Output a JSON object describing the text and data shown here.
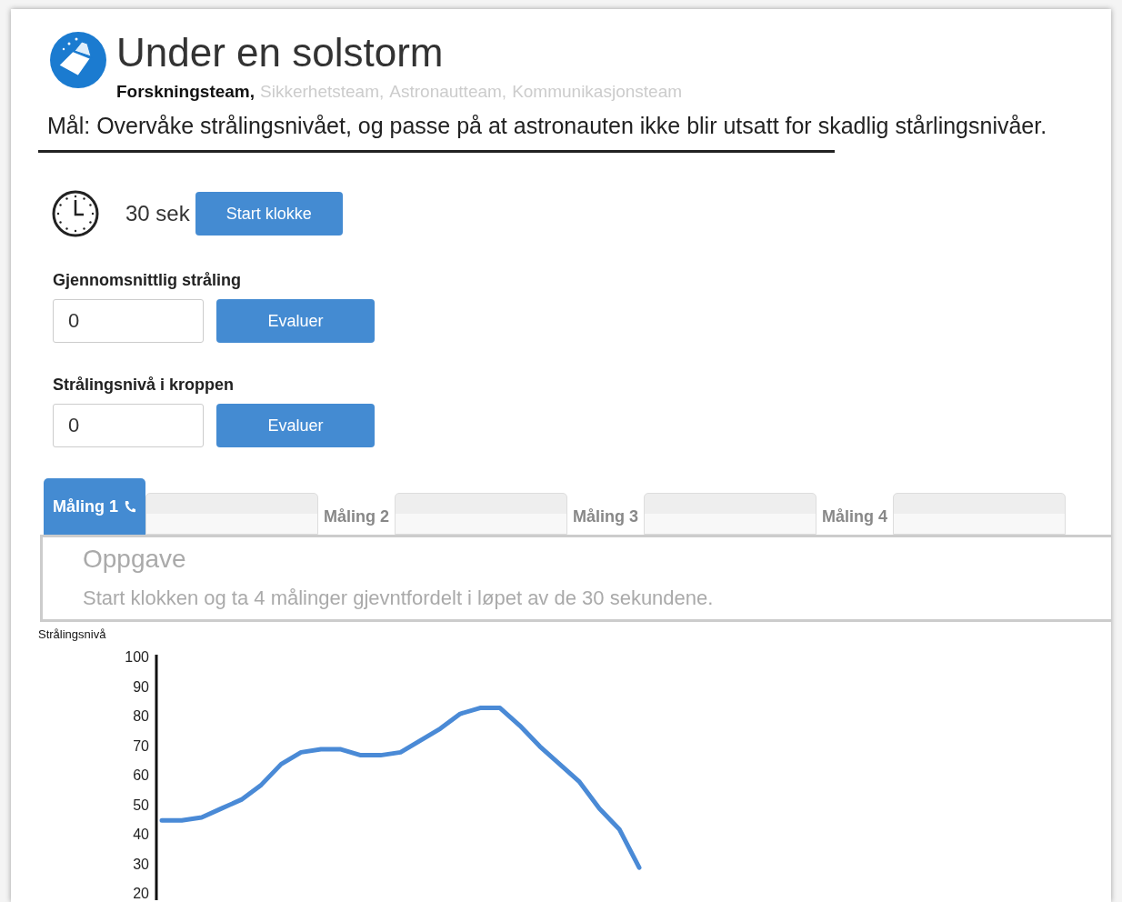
{
  "header": {
    "title": "Under en solstorm",
    "teams": [
      {
        "name": "Forskningsteam,",
        "active": true
      },
      {
        "name": "Sikkerhetsteam,",
        "active": false
      },
      {
        "name": "Astronautteam,",
        "active": false
      },
      {
        "name": "Kommunikasjonsteam",
        "active": false
      }
    ],
    "goal": "Mål: Overvåke strålingsnivået, og passe på at astronauten ikke blir utsatt for skadlig stårlingsnivåer."
  },
  "timer": {
    "time": "30 sek",
    "button": "Start klokke"
  },
  "evaluations": [
    {
      "label": "Gjennomsnittlig stråling",
      "value": "0",
      "button": "Evaluer"
    },
    {
      "label": "Strålingsnivå i kroppen",
      "value": "0",
      "button": "Evaluer"
    }
  ],
  "tabs": [
    {
      "label": "Måling 1",
      "selected": true
    },
    {
      "label": "Måling 2",
      "selected": false
    },
    {
      "label": "Måling 3",
      "selected": false
    },
    {
      "label": "Måling 4",
      "selected": false
    }
  ],
  "task": {
    "title": "Oppgave",
    "text": "Start klokken og ta 4 målinger gjevntfordelt i løpet av de 30 sekundene."
  },
  "chart_data": {
    "type": "line",
    "ylabel": "Strålingsnivå",
    "ylim": [
      17,
      100
    ],
    "yticks": [
      20,
      30,
      40,
      50,
      60,
      70,
      80,
      90,
      100
    ],
    "series": [
      {
        "color": "#4a8ad6",
        "values": [
          44,
          44,
          45,
          48,
          51,
          56,
          63,
          67,
          68,
          68,
          66,
          66,
          67,
          71,
          75,
          80,
          82,
          82,
          76,
          69,
          63,
          57,
          48,
          41,
          28
        ]
      }
    ]
  }
}
